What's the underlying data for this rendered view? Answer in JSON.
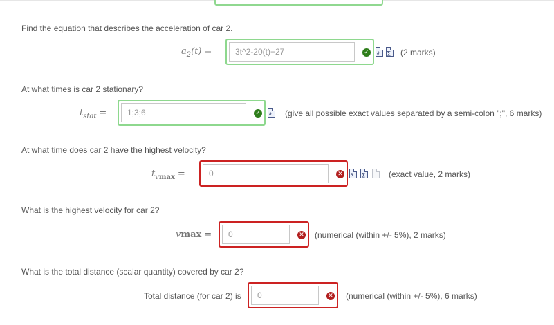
{
  "questions": [
    {
      "prompt": "Find the equation that describes the acceleration of car 2.",
      "var_main": "a",
      "var_sub": "2",
      "var_arg": "(t)",
      "eq": "=",
      "value": "3t^2-20(t)+27",
      "state": "correct",
      "hint": "(2 marks)"
    },
    {
      "prompt": "At what times is car 2 stationary?",
      "var_main": "t",
      "var_sub": "stat",
      "eq": "=",
      "value": "1;3;6",
      "state": "correct",
      "hint": "(give all possible exact values separated by a semi-colon \";\", 6 marks)"
    },
    {
      "prompt": "At what time does car 2 have the highest velocity?",
      "var_main": "t",
      "var_sub_italic": "v",
      "var_sub_upright": "max",
      "eq": "=",
      "value": "0",
      "state": "incorrect",
      "hint": "(exact value, 2 marks)"
    },
    {
      "prompt": "What is the highest velocity for car 2?",
      "var_main": "v",
      "var_upright": "max",
      "eq": "=",
      "value": "0",
      "state": "incorrect",
      "hint": "(numerical (within +/- 5%), 2 marks)"
    },
    {
      "prompt": "What is the total distance (scalar quantity) covered by car 2?",
      "label": "Total distance (for car 2) is",
      "value": "0",
      "state": "incorrect",
      "hint": "(numerical (within +/- 5%), 6 marks)"
    }
  ],
  "icons": {
    "correct": "check-circle-icon",
    "incorrect": "cross-circle-icon",
    "document": "document-icon",
    "blank_document": "blank-document-icon"
  },
  "colors": {
    "correct_border": "#8ed88e",
    "incorrect_border": "#cc2222",
    "correct_status": "#2e7d1a",
    "incorrect_status": "#b21f1f"
  }
}
